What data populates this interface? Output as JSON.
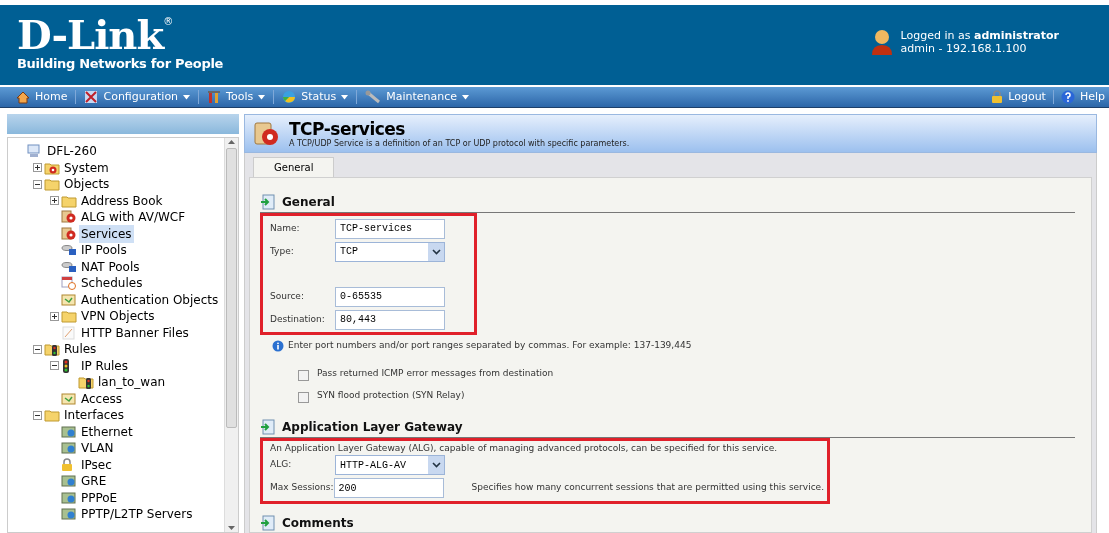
{
  "header": {
    "logo": "D-Link",
    "registered": "®",
    "tagline": "Building Networks for People",
    "login_prefix": "Logged in as ",
    "login_user": "administrator",
    "login_detail": "admin - 192.168.1.100"
  },
  "menu": [
    {
      "label": "Home",
      "dropdown": false
    },
    {
      "label": "Configuration",
      "dropdown": true
    },
    {
      "label": "Tools",
      "dropdown": true
    },
    {
      "label": "Status",
      "dropdown": true
    },
    {
      "label": "Maintenance",
      "dropdown": true
    }
  ],
  "menu_right": [
    {
      "label": "Logout"
    },
    {
      "label": "Help"
    }
  ],
  "tree": [
    {
      "label": "DFL-260",
      "kind": "device",
      "selected": false,
      "children": [
        {
          "label": "System",
          "kind": "gearfolder",
          "selected": false,
          "expanded": false
        },
        {
          "label": "Objects",
          "kind": "folder",
          "selected": false,
          "expanded": true,
          "children": [
            {
              "label": "Address Book",
              "kind": "folder",
              "selected": false,
              "expanded": false
            },
            {
              "label": "ALG with AV/WCF",
              "kind": "gear",
              "selected": false
            },
            {
              "label": "Services",
              "kind": "gear",
              "selected": true
            },
            {
              "label": "IP Pools",
              "kind": "pool",
              "selected": false
            },
            {
              "label": "NAT Pools",
              "kind": "pool",
              "selected": false
            },
            {
              "label": "Schedules",
              "kind": "calendar",
              "selected": false
            },
            {
              "label": "Authentication Objects",
              "kind": "cert",
              "selected": false
            },
            {
              "label": "VPN Objects",
              "kind": "folder",
              "selected": false,
              "expanded": false
            },
            {
              "label": "HTTP Banner Files",
              "kind": "file",
              "selected": false
            }
          ]
        },
        {
          "label": "Rules",
          "kind": "trafficfolder",
          "selected": false,
          "expanded": true,
          "children": [
            {
              "label": "IP Rules",
              "kind": "traffic",
              "selected": false,
              "expanded": true,
              "children": [
                {
                  "label": "lan_to_wan",
                  "kind": "trafficfolder",
                  "selected": false
                }
              ]
            },
            {
              "label": "Access",
              "kind": "cert",
              "selected": false
            }
          ]
        },
        {
          "label": "Interfaces",
          "kind": "folder",
          "selected": false,
          "expanded": true,
          "children": [
            {
              "label": "Ethernet",
              "kind": "net",
              "selected": false
            },
            {
              "label": "VLAN",
              "kind": "net",
              "selected": false
            },
            {
              "label": "IPsec",
              "kind": "lock",
              "selected": false
            },
            {
              "label": "GRE",
              "kind": "net",
              "selected": false
            },
            {
              "label": "PPPoE",
              "kind": "net",
              "selected": false
            },
            {
              "label": "PPTP/L2TP Servers",
              "kind": "net",
              "selected": false
            }
          ]
        }
      ]
    }
  ],
  "page": {
    "title": "TCP-services",
    "description": "A TCP/UDP Service is a definition of an TCP or UDP protocol with specific parameters."
  },
  "tabs": [
    {
      "label": "General",
      "selected": true
    }
  ],
  "sections": [
    {
      "title": "General",
      "highlighted": true,
      "fields": [
        {
          "kind": "text",
          "label": "Name:",
          "value": "TCP-services"
        },
        {
          "kind": "select",
          "label": "Type:",
          "value": "TCP"
        },
        {
          "kind": "spacer"
        },
        {
          "kind": "text",
          "label": "Source:",
          "value": "0-65535"
        },
        {
          "kind": "text",
          "label": "Destination:",
          "value": "80,443"
        }
      ],
      "info": "Enter port numbers and/or port ranges separated by commas. For example: 137-139,445",
      "checkboxes": [
        {
          "label": "Pass returned ICMP error messages from destination",
          "checked": false
        },
        {
          "label": "SYN flood protection (SYN Relay)",
          "checked": false
        }
      ]
    },
    {
      "title": "Application Layer Gateway",
      "highlighted": true,
      "description_above": "An Application Layer Gateway (ALG), capable of managing advanced protocols, can be specified for this service.",
      "fields": [
        {
          "kind": "select",
          "label": "ALG:",
          "value": "HTTP-ALG-AV"
        },
        {
          "kind": "text",
          "label": "Max Sessions:",
          "value": "200",
          "hint": "Specifies how many concurrent sessions that are permitted using this service."
        }
      ]
    },
    {
      "title": "Comments"
    }
  ]
}
